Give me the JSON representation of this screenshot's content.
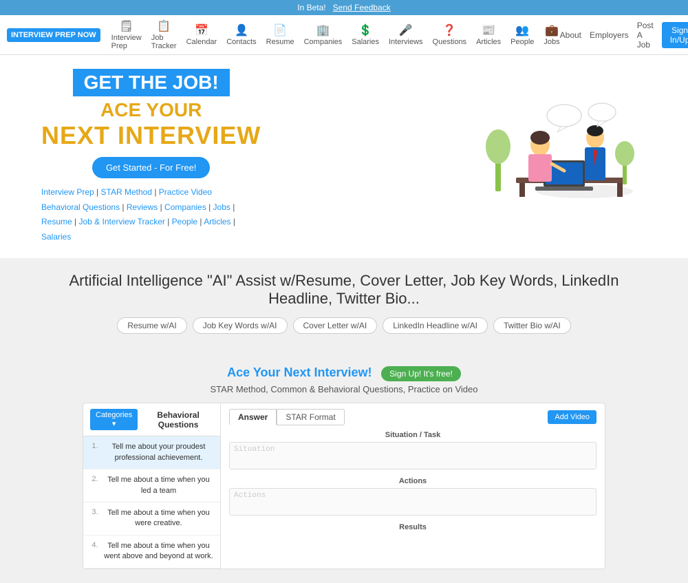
{
  "beta_bar": {
    "text": "In Beta!",
    "link_label": "Send Feedback"
  },
  "nav": {
    "brand": "INTERVIEW PREP NOW",
    "items": [
      {
        "id": "interview-prep",
        "icon": "🗒",
        "label": "Interview Prep"
      },
      {
        "id": "job-tracker",
        "icon": "📋",
        "label": "Job Tracker"
      },
      {
        "id": "calendar",
        "icon": "📅",
        "label": "Calendar"
      },
      {
        "id": "contacts",
        "icon": "👤",
        "label": "Contacts"
      },
      {
        "id": "resume",
        "icon": "📄",
        "label": "Resume"
      },
      {
        "id": "companies",
        "icon": "🏢",
        "label": "Companies"
      },
      {
        "id": "salaries",
        "icon": "💲",
        "label": "Salaries"
      },
      {
        "id": "interviews",
        "icon": "🎤",
        "label": "Interviews"
      },
      {
        "id": "questions",
        "icon": "❓",
        "label": "Questions"
      },
      {
        "id": "articles",
        "icon": "📰",
        "label": "Articles"
      },
      {
        "id": "people",
        "icon": "👥",
        "label": "People"
      },
      {
        "id": "jobs",
        "icon": "💼",
        "label": "Jobs"
      }
    ],
    "right_links": [
      "About",
      "Employers",
      "Post A Job"
    ],
    "signin_label": "Sign In/Up"
  },
  "hero": {
    "tag_line": "GET THE JOB!",
    "ace_line": "ACE YOUR",
    "next_line": "NEXT INTERVIEW",
    "cta_label": "Get Started - For Free!",
    "links_line1": "Interview Prep | STAR Method | Practice Video",
    "links_line2": "Behavioral Questions | Reviews | Companies | Jobs |",
    "links_line3": "Resume | Job & Interview Tracker | People | Articles |",
    "links_line4": "Salaries"
  },
  "ai_section": {
    "title": "Artificial Intelligence \"AI\" Assist w/Resume, Cover Letter, Job Key Words, LinkedIn Headline, Twitter Bio...",
    "tabs": [
      {
        "id": "resume-ai",
        "label": "Resume w/AI"
      },
      {
        "id": "job-keywords-ai",
        "label": "Job Key Words w/AI"
      },
      {
        "id": "cover-letter-ai",
        "label": "Cover Letter w/AI"
      },
      {
        "id": "linkedin-ai",
        "label": "LinkedIn Headline w/AI"
      },
      {
        "id": "twitter-ai",
        "label": "Twitter Bio w/AI"
      }
    ]
  },
  "interview_section": {
    "ace_label": "Ace Your Next Interview!",
    "signup_label": "Sign Up! It's free!",
    "subtitle": "STAR Method, Common & Behavioral Questions, Practice on Video"
  },
  "questions_panel": {
    "categories_btn": "Categories ▾",
    "header_title": "Behavioral Questions",
    "items": [
      {
        "num": "1.",
        "text": "Tell me about your proudest professional achievement.",
        "active": true
      },
      {
        "num": "2.",
        "text": "Tell me about a time when you led a team"
      },
      {
        "num": "3.",
        "text": "Tell me about a time when you were creative."
      },
      {
        "num": "4.",
        "text": "Tell me about a time when you went above and beyond at work."
      }
    ]
  },
  "answer_panel": {
    "tabs": [
      {
        "id": "answer",
        "label": "Answer",
        "active": true
      },
      {
        "id": "star-format",
        "label": "STAR Format"
      }
    ],
    "add_video_label": "Add Video",
    "fields": [
      {
        "id": "situation",
        "label": "Situation / Task",
        "placeholder": "Situation"
      },
      {
        "id": "actions",
        "label": "Actions",
        "placeholder": "Actions"
      },
      {
        "id": "results",
        "label": "Results"
      }
    ]
  }
}
